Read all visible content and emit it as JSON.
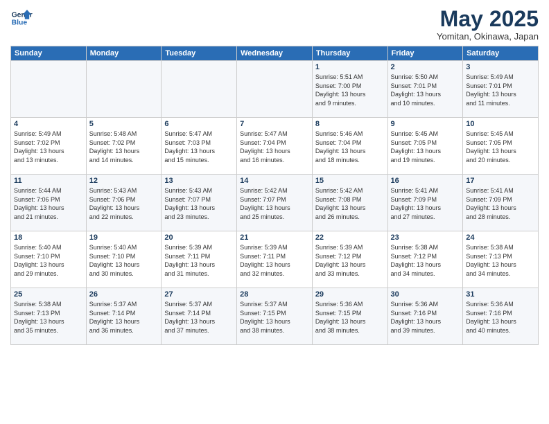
{
  "logo": {
    "line1": "General",
    "line2": "Blue"
  },
  "title": "May 2025",
  "location": "Yomitan, Okinawa, Japan",
  "days_of_week": [
    "Sunday",
    "Monday",
    "Tuesday",
    "Wednesday",
    "Thursday",
    "Friday",
    "Saturday"
  ],
  "weeks": [
    [
      {
        "day": "",
        "info": ""
      },
      {
        "day": "",
        "info": ""
      },
      {
        "day": "",
        "info": ""
      },
      {
        "day": "",
        "info": ""
      },
      {
        "day": "1",
        "info": "Sunrise: 5:51 AM\nSunset: 7:00 PM\nDaylight: 13 hours\nand 9 minutes."
      },
      {
        "day": "2",
        "info": "Sunrise: 5:50 AM\nSunset: 7:01 PM\nDaylight: 13 hours\nand 10 minutes."
      },
      {
        "day": "3",
        "info": "Sunrise: 5:49 AM\nSunset: 7:01 PM\nDaylight: 13 hours\nand 11 minutes."
      }
    ],
    [
      {
        "day": "4",
        "info": "Sunrise: 5:49 AM\nSunset: 7:02 PM\nDaylight: 13 hours\nand 13 minutes."
      },
      {
        "day": "5",
        "info": "Sunrise: 5:48 AM\nSunset: 7:02 PM\nDaylight: 13 hours\nand 14 minutes."
      },
      {
        "day": "6",
        "info": "Sunrise: 5:47 AM\nSunset: 7:03 PM\nDaylight: 13 hours\nand 15 minutes."
      },
      {
        "day": "7",
        "info": "Sunrise: 5:47 AM\nSunset: 7:04 PM\nDaylight: 13 hours\nand 16 minutes."
      },
      {
        "day": "8",
        "info": "Sunrise: 5:46 AM\nSunset: 7:04 PM\nDaylight: 13 hours\nand 18 minutes."
      },
      {
        "day": "9",
        "info": "Sunrise: 5:45 AM\nSunset: 7:05 PM\nDaylight: 13 hours\nand 19 minutes."
      },
      {
        "day": "10",
        "info": "Sunrise: 5:45 AM\nSunset: 7:05 PM\nDaylight: 13 hours\nand 20 minutes."
      }
    ],
    [
      {
        "day": "11",
        "info": "Sunrise: 5:44 AM\nSunset: 7:06 PM\nDaylight: 13 hours\nand 21 minutes."
      },
      {
        "day": "12",
        "info": "Sunrise: 5:43 AM\nSunset: 7:06 PM\nDaylight: 13 hours\nand 22 minutes."
      },
      {
        "day": "13",
        "info": "Sunrise: 5:43 AM\nSunset: 7:07 PM\nDaylight: 13 hours\nand 23 minutes."
      },
      {
        "day": "14",
        "info": "Sunrise: 5:42 AM\nSunset: 7:07 PM\nDaylight: 13 hours\nand 25 minutes."
      },
      {
        "day": "15",
        "info": "Sunrise: 5:42 AM\nSunset: 7:08 PM\nDaylight: 13 hours\nand 26 minutes."
      },
      {
        "day": "16",
        "info": "Sunrise: 5:41 AM\nSunset: 7:09 PM\nDaylight: 13 hours\nand 27 minutes."
      },
      {
        "day": "17",
        "info": "Sunrise: 5:41 AM\nSunset: 7:09 PM\nDaylight: 13 hours\nand 28 minutes."
      }
    ],
    [
      {
        "day": "18",
        "info": "Sunrise: 5:40 AM\nSunset: 7:10 PM\nDaylight: 13 hours\nand 29 minutes."
      },
      {
        "day": "19",
        "info": "Sunrise: 5:40 AM\nSunset: 7:10 PM\nDaylight: 13 hours\nand 30 minutes."
      },
      {
        "day": "20",
        "info": "Sunrise: 5:39 AM\nSunset: 7:11 PM\nDaylight: 13 hours\nand 31 minutes."
      },
      {
        "day": "21",
        "info": "Sunrise: 5:39 AM\nSunset: 7:11 PM\nDaylight: 13 hours\nand 32 minutes."
      },
      {
        "day": "22",
        "info": "Sunrise: 5:39 AM\nSunset: 7:12 PM\nDaylight: 13 hours\nand 33 minutes."
      },
      {
        "day": "23",
        "info": "Sunrise: 5:38 AM\nSunset: 7:12 PM\nDaylight: 13 hours\nand 34 minutes."
      },
      {
        "day": "24",
        "info": "Sunrise: 5:38 AM\nSunset: 7:13 PM\nDaylight: 13 hours\nand 34 minutes."
      }
    ],
    [
      {
        "day": "25",
        "info": "Sunrise: 5:38 AM\nSunset: 7:13 PM\nDaylight: 13 hours\nand 35 minutes."
      },
      {
        "day": "26",
        "info": "Sunrise: 5:37 AM\nSunset: 7:14 PM\nDaylight: 13 hours\nand 36 minutes."
      },
      {
        "day": "27",
        "info": "Sunrise: 5:37 AM\nSunset: 7:14 PM\nDaylight: 13 hours\nand 37 minutes."
      },
      {
        "day": "28",
        "info": "Sunrise: 5:37 AM\nSunset: 7:15 PM\nDaylight: 13 hours\nand 38 minutes."
      },
      {
        "day": "29",
        "info": "Sunrise: 5:36 AM\nSunset: 7:15 PM\nDaylight: 13 hours\nand 38 minutes."
      },
      {
        "day": "30",
        "info": "Sunrise: 5:36 AM\nSunset: 7:16 PM\nDaylight: 13 hours\nand 39 minutes."
      },
      {
        "day": "31",
        "info": "Sunrise: 5:36 AM\nSunset: 7:16 PM\nDaylight: 13 hours\nand 40 minutes."
      }
    ]
  ]
}
